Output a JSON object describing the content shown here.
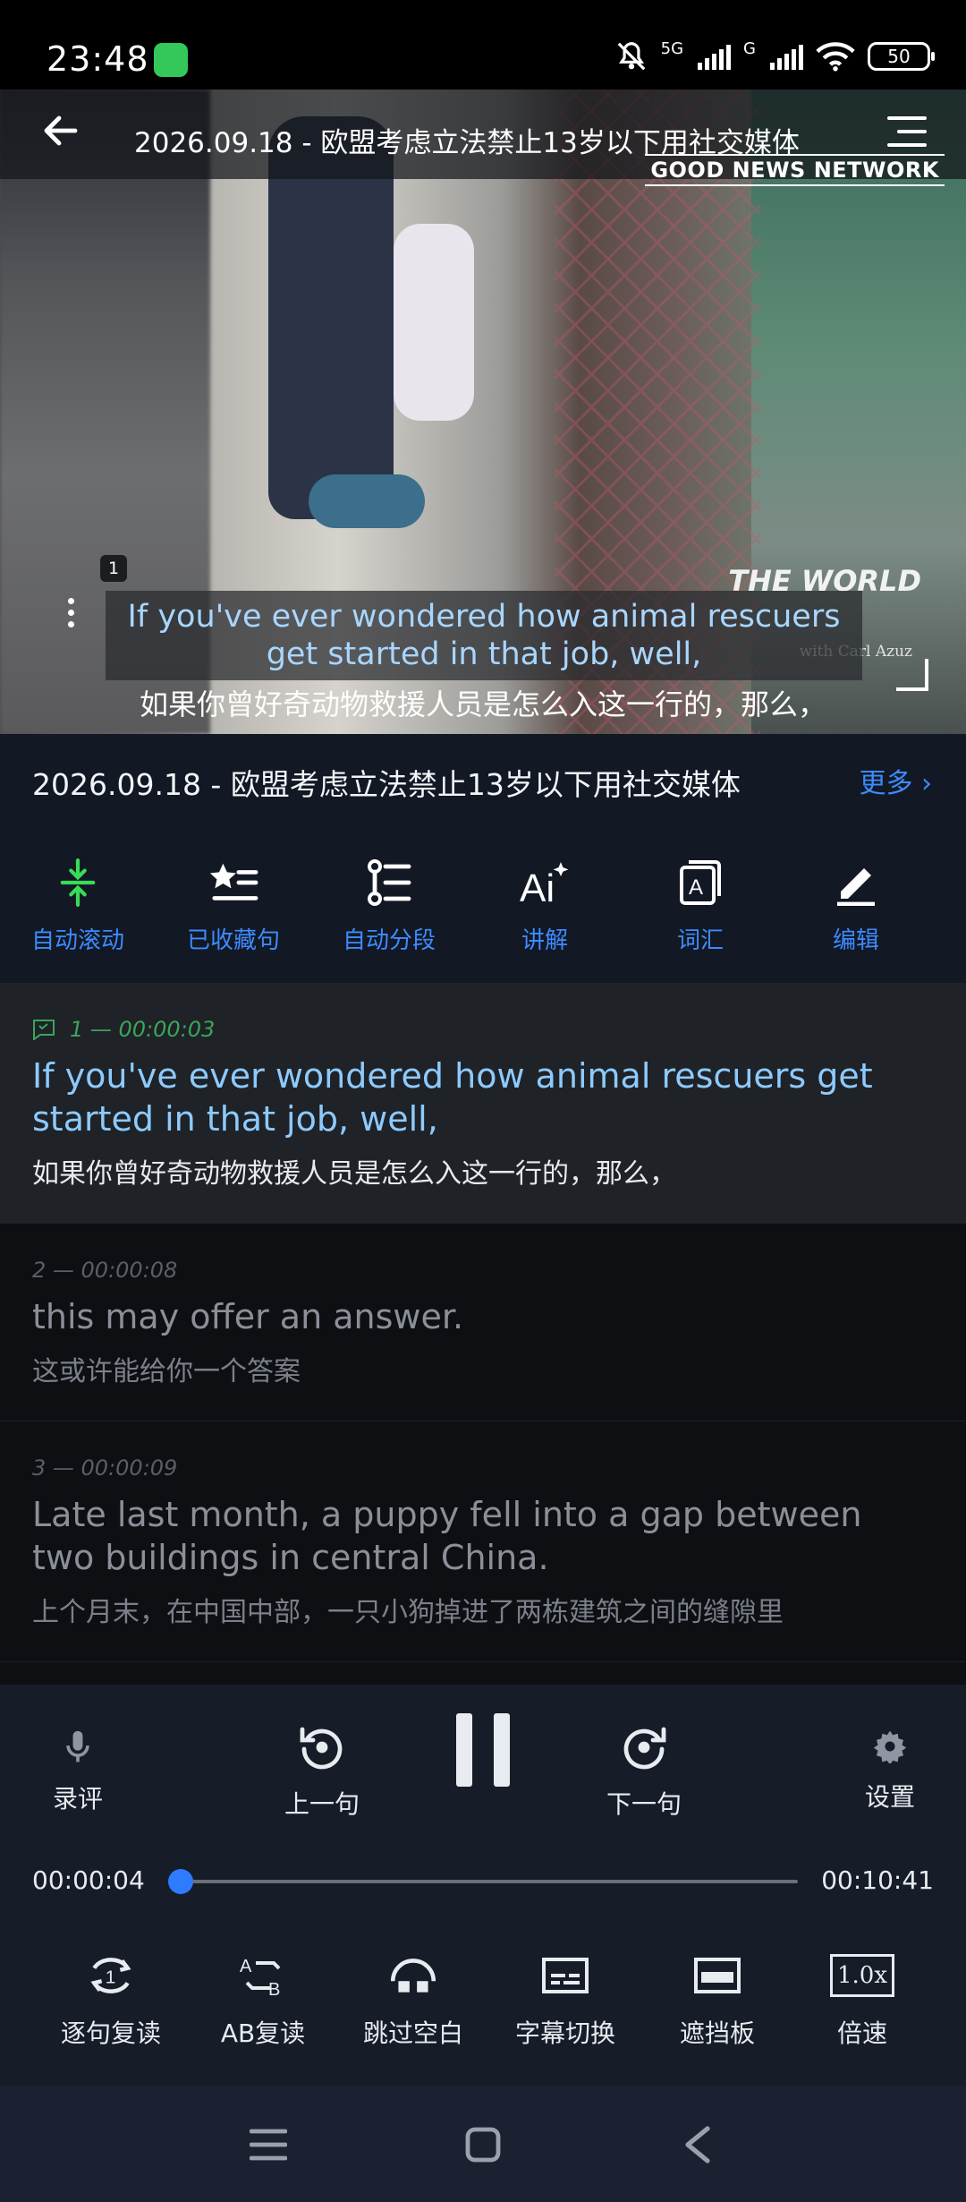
{
  "status_bar": {
    "time": "23:48",
    "network_1": "5G",
    "network_2": "G",
    "battery": "50",
    "icons": [
      "app-badge-icon",
      "mute-bell-icon",
      "signal-icon",
      "wifi-icon",
      "battery-icon"
    ]
  },
  "video": {
    "title": "2026.09.18 - 欧盟考虑立法禁止13岁以下用社交媒体",
    "watermark": "GOOD NEWS NETWORK",
    "logo": "THE WORLD",
    "logo_sub": "with Carl Azuz",
    "subtitle_index": "1",
    "subtitle_en": "If you've ever wondered how animal rescuers get started in that job, well,",
    "subtitle_zh": "如果你曾好奇动物救援人员是怎么入这一行的，那么，"
  },
  "info": {
    "title": "2026.09.18 - 欧盟考虑立法禁止13岁以下用社交媒体",
    "more": "更多"
  },
  "toolbar": [
    {
      "label": "自动滚动",
      "icon": "auto-scroll-icon",
      "color": "#3adb58"
    },
    {
      "label": "已收藏句",
      "icon": "star-list-icon",
      "color": "#ffffff"
    },
    {
      "label": "自动分段",
      "icon": "segment-list-icon",
      "color": "#ffffff"
    },
    {
      "label": "讲解",
      "icon": "ai-sparkle-icon",
      "color": "#ffffff"
    },
    {
      "label": "词汇",
      "icon": "vocabulary-icon",
      "color": "#ffffff"
    },
    {
      "label": "编辑",
      "icon": "pencil-icon",
      "color": "#ffffff"
    }
  ],
  "transcript": [
    {
      "meta": "1 — 00:00:03",
      "en": "If you've ever wondered how animal rescuers get started in that job, well,",
      "zh": "如果你曾好奇动物救援人员是怎么入这一行的，那么，",
      "active": true
    },
    {
      "meta": "2 — 00:00:08",
      "en": "this may offer an answer.",
      "zh": "这或许能给你一个答案",
      "active": false
    },
    {
      "meta": "3 — 00:00:09",
      "en": "Late last month, a puppy fell into a gap between two buildings in central China.",
      "zh": "上个月末，在中国中部，一只小狗掉进了两栋建筑之间的缝隙里",
      "active": false
    }
  ],
  "player": {
    "record_label": "录评",
    "prev_label": "上一句",
    "next_label": "下一句",
    "settings_label": "设置",
    "current_time": "00:00:04",
    "total_time": "00:10:41",
    "progress_fraction": 0.006,
    "accent": "#3d8bff"
  },
  "bottom_tools": [
    {
      "label": "逐句复读",
      "icon": "repeat-one-icon"
    },
    {
      "label": "AB复读",
      "icon": "ab-repeat-icon"
    },
    {
      "label": "跳过空白",
      "icon": "skip-blank-icon"
    },
    {
      "label": "字幕切换",
      "icon": "subtitle-switch-icon"
    },
    {
      "label": "遮挡板",
      "icon": "mask-board-icon"
    },
    {
      "label": "倍速",
      "icon": "speed-icon",
      "value": "1.0x"
    }
  ],
  "navbar": {
    "icons": [
      "nav-menu-icon",
      "nav-home-icon",
      "nav-back-icon"
    ]
  }
}
